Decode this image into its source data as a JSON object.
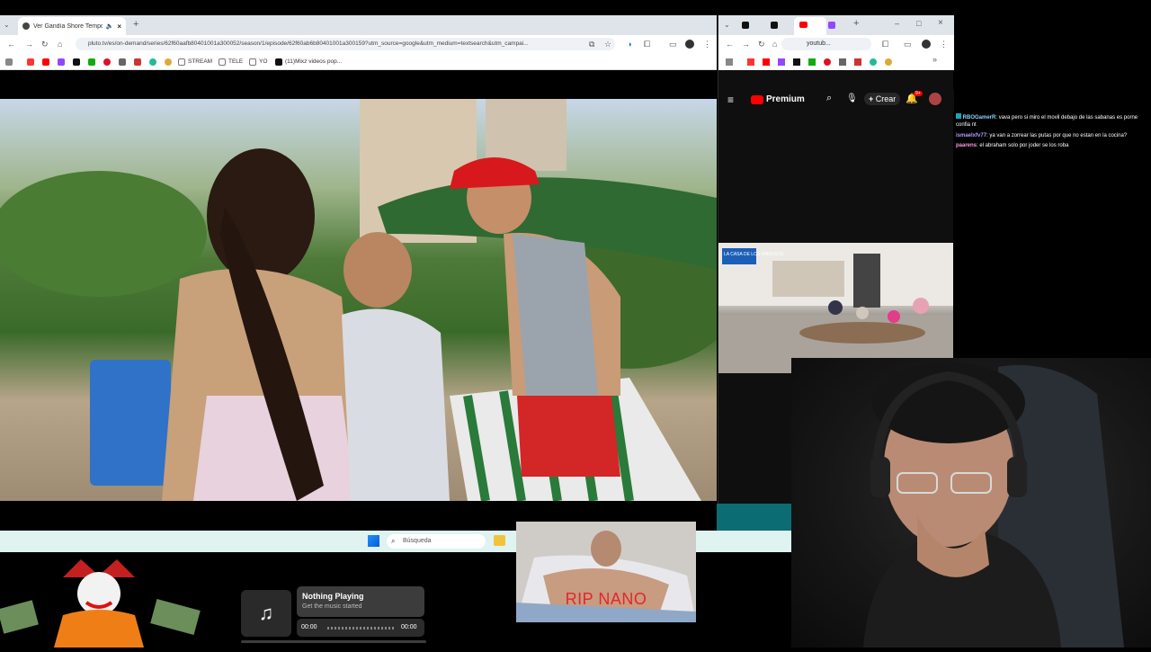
{
  "left_browser": {
    "tab_title": "Ver Gandía Shore Tempora...",
    "url": "pluto.tv/es/on-demand/series/62f60aafb80401001a300052/season/1/episode/62f60ab6b80401001a300159?utm_source=google&utm_medium=textsearch&utm_campai...",
    "bookmarks": [
      "STREAM",
      "TELE",
      "YO",
      "(11)Mixz videos pop..."
    ]
  },
  "right_browser": {
    "url": "youtub...",
    "youtube": {
      "logo_label": "Premium",
      "create_label": "Crear",
      "notification_count": "9+"
    },
    "mini_video_logo": "LA CASA DE LOS FAMOSOS"
  },
  "chat": [
    {
      "user": "RBOGamerR",
      "message": ": vava pero si miro el movil debajo de las sabanas es porne confia nt",
      "color": "#8bd5ff"
    },
    {
      "user": "ismaelxfv77",
      "message": ": ya van a zorrear las putas por que no estan en la cocina?",
      "color": "#b59cff"
    },
    {
      "user": "paarens",
      "message": ": el abraham solo por joder se los roba",
      "color": "#ff9de2"
    }
  ],
  "taskbar": {
    "search_placeholder": "Búsqueda"
  },
  "overlay": {
    "rip_text": "RIP NANO"
  },
  "music_widget": {
    "title": "Nothing Playing",
    "subtitle": "Get the music started",
    "time_current": "00:00",
    "time_total": "00:00"
  },
  "colors": {
    "accent_teal": "#0b7b86",
    "rip_red": "#e5252c",
    "youtube_red": "#ff0000"
  }
}
